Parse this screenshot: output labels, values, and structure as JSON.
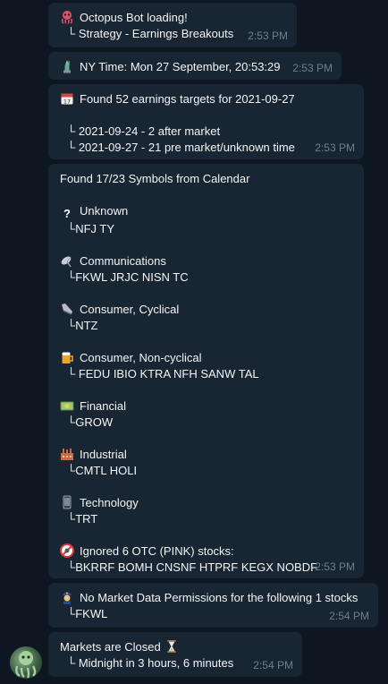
{
  "messages": {
    "m1": {
      "icon": "octopus-icon",
      "title": "Octopus Bot loading!",
      "line": "└ Strategy - Earnings Breakouts",
      "time": "2:53 PM"
    },
    "m2": {
      "icon": "statue-of-liberty-icon",
      "text": "NY Time: Mon 27 September, 20:53:29",
      "time": "2:53 PM"
    },
    "m3": {
      "icon": "calendar-icon",
      "title": "Found 52 earnings targets for 2021-09-27",
      "lines": [
        "└ 2021-09-24 - 2 after market",
        "└ 2021-09-27 - 21 pre market/unknown time"
      ],
      "time": "2:53 PM"
    },
    "m4": {
      "title": "Found 17/23 Symbols from Calendar",
      "sections": [
        {
          "icon": "question-mark-icon",
          "name": "Unknown",
          "symbols": "└NFJ TY"
        },
        {
          "icon": "satellite-antenna-icon",
          "name": "Communications",
          "symbols": "└FKWL JRJC NISN TC"
        },
        {
          "icon": "sneaker-icon",
          "name": "Consumer, Cyclical",
          "symbols": "└NTZ"
        },
        {
          "icon": "beer-mug-icon",
          "name": "Consumer, Non-cyclical",
          "symbols": "└ FEDU IBIO KTRA NFH SANW TAL"
        },
        {
          "icon": "money-icon",
          "name": "Financial",
          "symbols": "└GROW"
        },
        {
          "icon": "factory-icon",
          "name": "Industrial",
          "symbols": "└CMTL HOLI"
        },
        {
          "icon": "mobile-phone-icon",
          "name": "Technology",
          "symbols": "└TRT"
        },
        {
          "icon": "no-entry-icon",
          "name": "Ignored 6 OTC (PINK) stocks:",
          "symbols": "└BKRRF BOMH CNSNF HTPRF KEGX NOBDF"
        }
      ],
      "time": "2:53 PM"
    },
    "m5": {
      "icon": "police-officer-icon",
      "title": "No Market Data Permissions for the following 1 stocks",
      "line": "└FKWL",
      "time": "2:54 PM"
    },
    "m6": {
      "icon": "hourglass-icon",
      "title": "Markets are Closed",
      "line": "└ Midnight in 3 hours, 6 minutes",
      "time": "2:54 PM"
    }
  },
  "colors": {
    "background": "#0e1621",
    "bubble": "#182533",
    "time": "#6d7f8f",
    "text": "#f5f5f5"
  }
}
